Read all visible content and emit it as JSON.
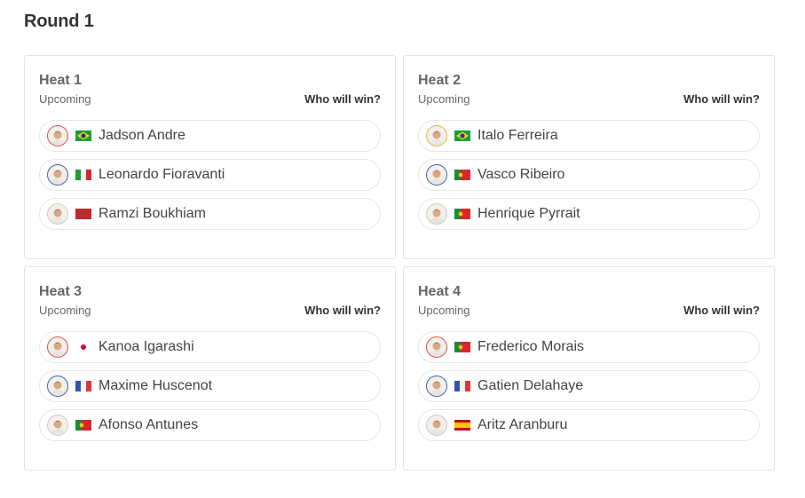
{
  "round": {
    "title": "Round 1"
  },
  "colors": {
    "avatar_ring_red": "#d9534f",
    "avatar_ring_blue": "#3a66b0",
    "avatar_ring_gold": "#e0b64a",
    "avatar_ring_none": "#cccccc"
  },
  "heats": [
    {
      "title": "Heat 1",
      "status": "Upcoming",
      "cta": "Who will win?",
      "surfers": [
        {
          "name": "Jadson Andre",
          "flag": "brazil",
          "avatar_ring": "red",
          "avatar_icon": "surfer-photo-icon"
        },
        {
          "name": "Leonardo Fioravanti",
          "flag": "italy",
          "avatar_ring": "blue",
          "avatar_icon": "surfer-photo-icon"
        },
        {
          "name": "Ramzi Boukhiam",
          "flag": "morocco",
          "avatar_ring": "none",
          "avatar_icon": "surfer-photo-icon"
        }
      ]
    },
    {
      "title": "Heat 2",
      "status": "Upcoming",
      "cta": "Who will win?",
      "surfers": [
        {
          "name": "Italo Ferreira",
          "flag": "brazil",
          "avatar_ring": "gold",
          "avatar_icon": "surfer-photo-icon"
        },
        {
          "name": "Vasco Ribeiro",
          "flag": "portugal",
          "avatar_ring": "blue",
          "avatar_icon": "surfer-photo-icon"
        },
        {
          "name": "Henrique Pyrrait",
          "flag": "portugal",
          "avatar_ring": "none",
          "avatar_icon": "surfer-photo-icon"
        }
      ]
    },
    {
      "title": "Heat 3",
      "status": "Upcoming",
      "cta": "Who will win?",
      "surfers": [
        {
          "name": "Kanoa Igarashi",
          "flag": "japan",
          "avatar_ring": "red",
          "avatar_icon": "surfer-photo-icon"
        },
        {
          "name": "Maxime Huscenot",
          "flag": "france",
          "avatar_ring": "blue",
          "avatar_icon": "surfer-photo-icon"
        },
        {
          "name": "Afonso Antunes",
          "flag": "portugal",
          "avatar_ring": "none",
          "avatar_icon": "surfer-photo-icon"
        }
      ]
    },
    {
      "title": "Heat 4",
      "status": "Upcoming",
      "cta": "Who will win?",
      "surfers": [
        {
          "name": "Frederico Morais",
          "flag": "portugal",
          "avatar_ring": "red",
          "avatar_icon": "surfer-photo-icon"
        },
        {
          "name": "Gatien Delahaye",
          "flag": "france",
          "avatar_ring": "blue",
          "avatar_icon": "surfer-photo-icon"
        },
        {
          "name": "Aritz Aranburu",
          "flag": "spain",
          "avatar_ring": "none",
          "avatar_icon": "surfer-photo-icon"
        }
      ]
    }
  ]
}
